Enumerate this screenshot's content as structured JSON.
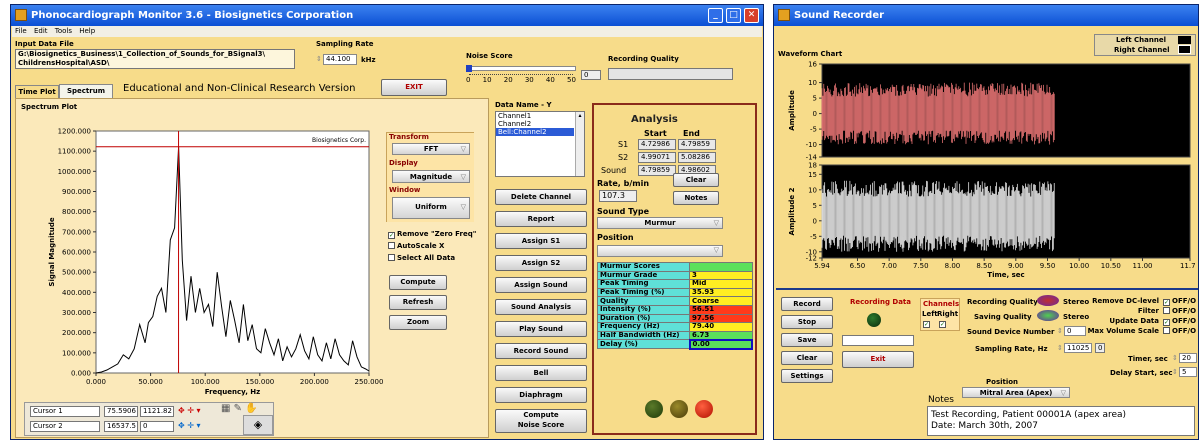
{
  "left_window": {
    "title": "Phonocardiograph Monitor 3.6 - Biosignetics Corporation",
    "menu": [
      "File",
      "Edit",
      "Tools",
      "Help"
    ],
    "input_data_label": "Input Data File",
    "input_file_line1": "G:\\Biosignetics_Business\\1_Collection_of_Sounds_for_BSignal3\\",
    "input_file_line2": "ChildrensHospital\\ASD\\",
    "sampling_rate_label": "Sampling Rate",
    "sampling_rate_value": "44.100",
    "sampling_rate_unit": "kHz",
    "noise_score_label": "Noise Score",
    "noise_scale_ticks": [
      "0",
      "10",
      "20",
      "30",
      "40",
      "50"
    ],
    "noise_value": "0",
    "recording_quality_label": "Recording Quality",
    "exit_label": "EXIT",
    "tabs": [
      "Time Plot",
      "Spectrum"
    ],
    "version_text": "Educational and Non-Clinical Research Version",
    "spectrum_plot_label": "Spectrum Plot",
    "watermark": "Biosignetics Corp.",
    "transform_label": "Transform",
    "transform_value": "FFT",
    "display_label": "Display",
    "display_value": "Magnitude",
    "window_label": "Window",
    "window_value": "Uniform",
    "checkboxes": [
      {
        "label": "Remove \"Zero Freq\"",
        "checked": true
      },
      {
        "label": "AutoScale X",
        "checked": false
      },
      {
        "label": "Select All Data",
        "checked": false
      }
    ],
    "side_buttons": [
      "Compute",
      "Refresh",
      "Zoom"
    ],
    "cursors": [
      {
        "name": "Cursor 1",
        "x": "75.5906",
        "y": "1121.82"
      },
      {
        "name": "Cursor 2",
        "x": "16537.5",
        "y": "0"
      }
    ],
    "data_name_label": "Data Name - Y",
    "data_names": [
      "Channel1",
      "Channel2",
      "Bell:Channel2"
    ],
    "action_buttons": [
      "Delete Channel",
      "Report",
      "Assign S1",
      "Assign S2",
      "Assign Sound",
      "Sound Analysis",
      "Play Sound",
      "Record Sound",
      "Bell",
      "Diaphragm",
      "Compute\nNoise Score"
    ],
    "analysis_title": "Analysis",
    "start_label": "Start",
    "end_label": "End",
    "analysis_rows": [
      {
        "label": "S1",
        "start": "4.72986",
        "end": "4.79859"
      },
      {
        "label": "S2",
        "start": "4.99071",
        "end": "5.08286"
      },
      {
        "label": "Sound",
        "start": "4.79859",
        "end": "4.98602"
      }
    ],
    "rate_label": "Rate, b/min",
    "rate_value": "107.3",
    "clear_label": "Clear",
    "notes_label": "Notes",
    "sound_type_label": "Sound Type",
    "sound_type_value": "Murmur",
    "position_label": "Position",
    "murmur_table": [
      {
        "label": "Murmur Scores",
        "value": "",
        "color": "#5be05b"
      },
      {
        "label": "Murmur Grade",
        "value": "3",
        "color": "#ffee22"
      },
      {
        "label": "Peak Timing",
        "value": "Mid",
        "color": "#ffee22"
      },
      {
        "label": "Peak Timing (%)",
        "value": "35.93",
        "color": "#ffee22"
      },
      {
        "label": "Quality",
        "value": "Coarse",
        "color": "#ffee22"
      },
      {
        "label": "Intensity (%)",
        "value": "56.51",
        "color": "#ff3a1a"
      },
      {
        "label": "Duration (%)",
        "value": "97.56",
        "color": "#ff3a1a"
      },
      {
        "label": "Frequency (Hz)",
        "value": "79.40",
        "color": "#ffee22"
      },
      {
        "label": "Half Bandwidth (Hz)",
        "value": "6.73",
        "color": "#5be05b"
      },
      {
        "label": "Delay (%)",
        "value": "0.00",
        "color": "#5be05b"
      }
    ]
  },
  "right_window": {
    "title": "Sound Recorder",
    "legend": [
      "Left Channel",
      "Right Channel"
    ],
    "waveform_chart_label": "Waveform Chart",
    "record_buttons": [
      "Record",
      "Stop",
      "Save",
      "Clear",
      "Settings"
    ],
    "recording_data_label": "Recording Data",
    "exit_label": "Exit",
    "channels_label": "Channels",
    "left_label": "Left",
    "right_label": "Right",
    "recording_quality_label": "Recording Quality",
    "saving_quality_label": "Saving Quality",
    "stereo_label": "Stereo",
    "sound_device_label": "Sound Device Number",
    "sound_device_value": "0",
    "sampling_rate_label": "Sampling Rate, Hz",
    "sampling_rate_value": "11025",
    "sampling_rate_extra": "0",
    "position_label": "Position",
    "position_value": "Mitral Area (Apex)",
    "options": [
      {
        "label": "Remove DC-level",
        "state": "OFF/O"
      },
      {
        "label": "Filter",
        "state": "OFF/O"
      },
      {
        "label": "Update Data",
        "state": "OFF/O"
      },
      {
        "label": "Max Volume Scale",
        "state": "OFF/O"
      }
    ],
    "timer_label": "Timer, sec",
    "timer_value": "20",
    "delay_label": "Delay Start, sec",
    "delay_value": "5",
    "notes_label": "Notes",
    "notes_line1": "Test Recording, Patient 00001A (apex area)",
    "notes_line2": "Date: March 30th, 2007"
  },
  "chart_data": [
    {
      "type": "line",
      "title": "Spectrum Plot",
      "xlabel": "Frequency, Hz",
      "ylabel": "Signal Magnitude",
      "xlim": [
        0,
        250
      ],
      "ylim": [
        0,
        1200
      ],
      "xticks": [
        "0.000",
        "50.000",
        "100.000",
        "150.000",
        "200.000",
        "250.000"
      ],
      "yticks": [
        "0.000",
        "100.000",
        "200.000",
        "300.000",
        "400.000",
        "500.000",
        "600.000",
        "700.000",
        "800.000",
        "900.000",
        "1000.000",
        "1100.000",
        "1200.000"
      ],
      "series": [
        {
          "x": [
            0,
            5,
            10,
            15,
            20,
            25,
            30,
            35,
            40,
            45,
            48,
            52,
            56,
            60,
            64,
            68,
            72,
            75.6,
            79,
            83,
            87,
            91,
            95,
            99,
            103,
            107,
            111,
            115,
            119,
            123,
            127,
            131,
            135,
            139,
            143,
            147,
            151,
            155,
            159,
            163,
            167,
            171,
            175,
            179,
            183,
            187,
            191,
            195,
            199,
            203,
            207,
            211,
            215,
            219,
            223,
            227,
            231,
            235,
            239,
            243,
            247,
            250
          ],
          "values": [
            0,
            5,
            15,
            30,
            45,
            90,
            70,
            120,
            240,
            150,
            250,
            280,
            380,
            420,
            300,
            660,
            720,
            1121.8,
            560,
            260,
            480,
            300,
            420,
            300,
            340,
            230,
            500,
            330,
            180,
            360,
            260,
            150,
            340,
            160,
            240,
            120,
            100,
            220,
            150,
            90,
            170,
            60,
            130,
            80,
            120,
            190,
            110,
            70,
            180,
            90,
            60,
            150,
            70,
            170,
            90,
            60,
            40,
            160,
            80,
            30,
            20,
            10
          ]
        }
      ],
      "cursors": [
        {
          "name": "Cursor 1",
          "x": 75.5906,
          "y": 1121.82
        }
      ]
    },
    {
      "type": "line",
      "title": "Waveform Chart",
      "xlabel": "Time, sec",
      "ylabel": "Amplitude",
      "xlim": [
        5.94,
        11.75
      ],
      "ylim": [
        -14,
        16
      ],
      "xticks": [
        "5.94",
        "6.50",
        "7.00",
        "7.50",
        "8.00",
        "8.50",
        "9.00",
        "9.50",
        "10.00",
        "10.50",
        "11.00",
        "11.75"
      ],
      "yticks": [
        "-14",
        "-10",
        "-5",
        "0",
        "5",
        "10",
        "16"
      ],
      "series": [
        {
          "name": "Left Channel",
          "x_range": [
            5.94,
            9.62
          ],
          "amplitude": [
            -10,
            10
          ]
        }
      ]
    },
    {
      "type": "line",
      "title": "",
      "xlabel": "Time, sec",
      "ylabel": "Amplitude 2",
      "xlim": [
        5.94,
        11.75
      ],
      "ylim": [
        -12,
        18
      ],
      "yticks": [
        "-12",
        "-10",
        "-5",
        "0",
        "5",
        "10",
        "15",
        "18"
      ],
      "series": [
        {
          "name": "Right Channel",
          "x_range": [
            5.94,
            9.62
          ],
          "amplitude": [
            -10,
            13
          ]
        }
      ]
    }
  ]
}
